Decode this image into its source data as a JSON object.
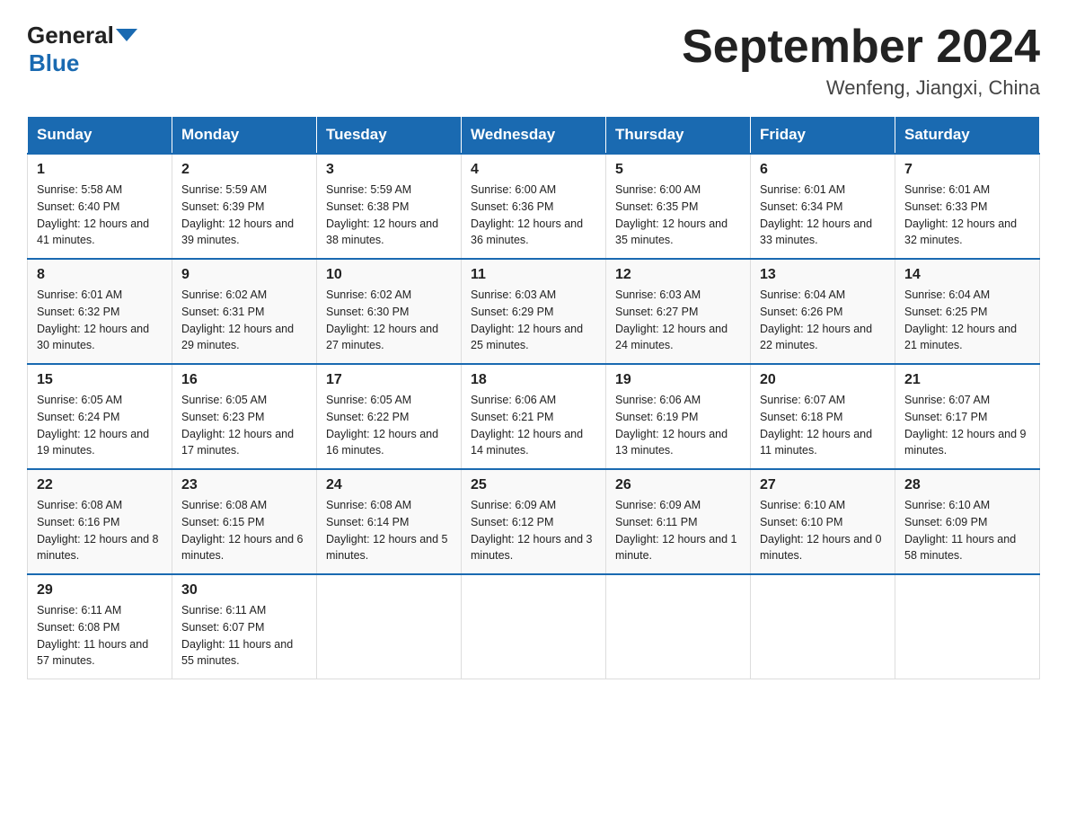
{
  "logo": {
    "text_general": "General",
    "text_blue": "Blue",
    "arrow_color": "#1a6ab1"
  },
  "title": "September 2024",
  "location": "Wenfeng, Jiangxi, China",
  "days_of_week": [
    "Sunday",
    "Monday",
    "Tuesday",
    "Wednesday",
    "Thursday",
    "Friday",
    "Saturday"
  ],
  "weeks": [
    [
      {
        "day": "1",
        "sunrise": "Sunrise: 5:58 AM",
        "sunset": "Sunset: 6:40 PM",
        "daylight": "Daylight: 12 hours and 41 minutes."
      },
      {
        "day": "2",
        "sunrise": "Sunrise: 5:59 AM",
        "sunset": "Sunset: 6:39 PM",
        "daylight": "Daylight: 12 hours and 39 minutes."
      },
      {
        "day": "3",
        "sunrise": "Sunrise: 5:59 AM",
        "sunset": "Sunset: 6:38 PM",
        "daylight": "Daylight: 12 hours and 38 minutes."
      },
      {
        "day": "4",
        "sunrise": "Sunrise: 6:00 AM",
        "sunset": "Sunset: 6:36 PM",
        "daylight": "Daylight: 12 hours and 36 minutes."
      },
      {
        "day": "5",
        "sunrise": "Sunrise: 6:00 AM",
        "sunset": "Sunset: 6:35 PM",
        "daylight": "Daylight: 12 hours and 35 minutes."
      },
      {
        "day": "6",
        "sunrise": "Sunrise: 6:01 AM",
        "sunset": "Sunset: 6:34 PM",
        "daylight": "Daylight: 12 hours and 33 minutes."
      },
      {
        "day": "7",
        "sunrise": "Sunrise: 6:01 AM",
        "sunset": "Sunset: 6:33 PM",
        "daylight": "Daylight: 12 hours and 32 minutes."
      }
    ],
    [
      {
        "day": "8",
        "sunrise": "Sunrise: 6:01 AM",
        "sunset": "Sunset: 6:32 PM",
        "daylight": "Daylight: 12 hours and 30 minutes."
      },
      {
        "day": "9",
        "sunrise": "Sunrise: 6:02 AM",
        "sunset": "Sunset: 6:31 PM",
        "daylight": "Daylight: 12 hours and 29 minutes."
      },
      {
        "day": "10",
        "sunrise": "Sunrise: 6:02 AM",
        "sunset": "Sunset: 6:30 PM",
        "daylight": "Daylight: 12 hours and 27 minutes."
      },
      {
        "day": "11",
        "sunrise": "Sunrise: 6:03 AM",
        "sunset": "Sunset: 6:29 PM",
        "daylight": "Daylight: 12 hours and 25 minutes."
      },
      {
        "day": "12",
        "sunrise": "Sunrise: 6:03 AM",
        "sunset": "Sunset: 6:27 PM",
        "daylight": "Daylight: 12 hours and 24 minutes."
      },
      {
        "day": "13",
        "sunrise": "Sunrise: 6:04 AM",
        "sunset": "Sunset: 6:26 PM",
        "daylight": "Daylight: 12 hours and 22 minutes."
      },
      {
        "day": "14",
        "sunrise": "Sunrise: 6:04 AM",
        "sunset": "Sunset: 6:25 PM",
        "daylight": "Daylight: 12 hours and 21 minutes."
      }
    ],
    [
      {
        "day": "15",
        "sunrise": "Sunrise: 6:05 AM",
        "sunset": "Sunset: 6:24 PM",
        "daylight": "Daylight: 12 hours and 19 minutes."
      },
      {
        "day": "16",
        "sunrise": "Sunrise: 6:05 AM",
        "sunset": "Sunset: 6:23 PM",
        "daylight": "Daylight: 12 hours and 17 minutes."
      },
      {
        "day": "17",
        "sunrise": "Sunrise: 6:05 AM",
        "sunset": "Sunset: 6:22 PM",
        "daylight": "Daylight: 12 hours and 16 minutes."
      },
      {
        "day": "18",
        "sunrise": "Sunrise: 6:06 AM",
        "sunset": "Sunset: 6:21 PM",
        "daylight": "Daylight: 12 hours and 14 minutes."
      },
      {
        "day": "19",
        "sunrise": "Sunrise: 6:06 AM",
        "sunset": "Sunset: 6:19 PM",
        "daylight": "Daylight: 12 hours and 13 minutes."
      },
      {
        "day": "20",
        "sunrise": "Sunrise: 6:07 AM",
        "sunset": "Sunset: 6:18 PM",
        "daylight": "Daylight: 12 hours and 11 minutes."
      },
      {
        "day": "21",
        "sunrise": "Sunrise: 6:07 AM",
        "sunset": "Sunset: 6:17 PM",
        "daylight": "Daylight: 12 hours and 9 minutes."
      }
    ],
    [
      {
        "day": "22",
        "sunrise": "Sunrise: 6:08 AM",
        "sunset": "Sunset: 6:16 PM",
        "daylight": "Daylight: 12 hours and 8 minutes."
      },
      {
        "day": "23",
        "sunrise": "Sunrise: 6:08 AM",
        "sunset": "Sunset: 6:15 PM",
        "daylight": "Daylight: 12 hours and 6 minutes."
      },
      {
        "day": "24",
        "sunrise": "Sunrise: 6:08 AM",
        "sunset": "Sunset: 6:14 PM",
        "daylight": "Daylight: 12 hours and 5 minutes."
      },
      {
        "day": "25",
        "sunrise": "Sunrise: 6:09 AM",
        "sunset": "Sunset: 6:12 PM",
        "daylight": "Daylight: 12 hours and 3 minutes."
      },
      {
        "day": "26",
        "sunrise": "Sunrise: 6:09 AM",
        "sunset": "Sunset: 6:11 PM",
        "daylight": "Daylight: 12 hours and 1 minute."
      },
      {
        "day": "27",
        "sunrise": "Sunrise: 6:10 AM",
        "sunset": "Sunset: 6:10 PM",
        "daylight": "Daylight: 12 hours and 0 minutes."
      },
      {
        "day": "28",
        "sunrise": "Sunrise: 6:10 AM",
        "sunset": "Sunset: 6:09 PM",
        "daylight": "Daylight: 11 hours and 58 minutes."
      }
    ],
    [
      {
        "day": "29",
        "sunrise": "Sunrise: 6:11 AM",
        "sunset": "Sunset: 6:08 PM",
        "daylight": "Daylight: 11 hours and 57 minutes."
      },
      {
        "day": "30",
        "sunrise": "Sunrise: 6:11 AM",
        "sunset": "Sunset: 6:07 PM",
        "daylight": "Daylight: 11 hours and 55 minutes."
      },
      null,
      null,
      null,
      null,
      null
    ]
  ]
}
